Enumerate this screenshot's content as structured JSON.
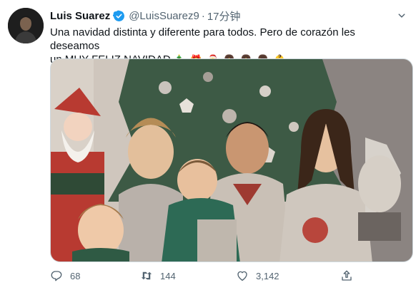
{
  "tweet": {
    "author_name": "Luis Suarez",
    "handle": "@LuisSuarez9",
    "separator": "·",
    "time": "17分钟",
    "text_line1": "Una navidad distinta y diferente para todos. Pero de corazón les deseamos",
    "text_line2": "un MUY FELIZ NAVIDAD",
    "emojis": [
      "🎄",
      "🎁",
      "🎅",
      "👧",
      "👧",
      "👦",
      "👶"
    ],
    "image_description_alt": "Family christmas photo"
  },
  "actions": {
    "reply_count": "68",
    "retweet_count": "144",
    "like_count": "3,142",
    "share_label": ""
  },
  "colors": {
    "verified": "#1d9bf0",
    "muted": "#536471"
  }
}
